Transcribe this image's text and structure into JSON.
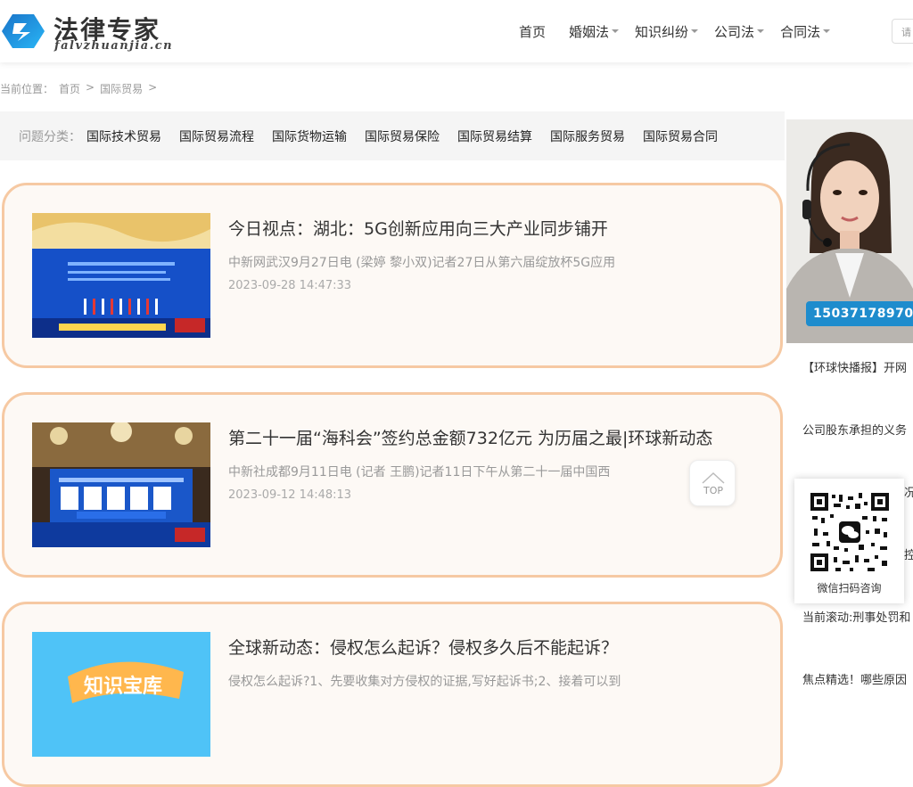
{
  "header": {
    "logo_cn": "法律专家",
    "logo_en": "falvzhuanjia.cn",
    "nav": [
      {
        "label": "首页",
        "has_dropdown": false
      },
      {
        "label": "婚姻法",
        "has_dropdown": true
      },
      {
        "label": "知识纠纷",
        "has_dropdown": true
      },
      {
        "label": "公司法",
        "has_dropdown": true
      },
      {
        "label": "合同法",
        "has_dropdown": true
      }
    ],
    "search_placeholder": "请"
  },
  "breadcrumb": {
    "prefix": "当前位置：",
    "items": [
      "首页",
      ">",
      "国际贸易",
      ">"
    ]
  },
  "categories": {
    "label": "问题分类：",
    "items": [
      "国际技术贸易",
      "国际贸易流程",
      "国际货物运输",
      "国际贸易保险",
      "国际贸易结算",
      "国际服务贸易",
      "国际贸易合同"
    ]
  },
  "articles": [
    {
      "title": "今日视点：湖北：5G创新应用向三大产业同步铺开",
      "desc": "中新网武汉9月27日电 (梁婷 黎小双)记者27日从第六届绽放杯5G应用",
      "date": "2023-09-28 14:47:33"
    },
    {
      "title": "第二十一届“海科会”签约总金额732亿元 为历届之最|环球新动态",
      "desc": "中新社成都9月11日电 (记者 王鹏)记者11日下午从第二十一届中国西",
      "date": "2023-09-12 14:48:13"
    },
    {
      "title": "全球新动态：侵权怎么起诉？侵权多久后不能起诉？",
      "desc": "侵权怎么起诉?1、先要收集对方侵权的证据,写好起诉书;2、接着可以到",
      "date": ""
    }
  ],
  "sidebar": {
    "phone": "15037178970",
    "links": [
      "【环球快播报】开网",
      "公司股东承担的义务",
      "况",
      "控",
      "当前滚动:刑事处罚和",
      "焦点精选！哪些原因"
    ],
    "qr_caption": "微信扫码咨询"
  },
  "top_button": {
    "label": "TOP"
  },
  "colors": {
    "card_border": "#f6c9a3",
    "card_bg": "#fdf9f5",
    "phone_badge": "#1e8ccd",
    "logo_blue": "#1a73c8"
  }
}
